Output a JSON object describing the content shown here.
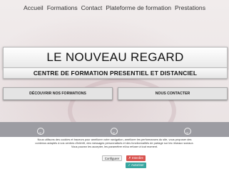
{
  "nav": {
    "items": [
      "Accueil",
      "Formations",
      "Contact",
      "Plateforme de formation",
      "Prestations"
    ]
  },
  "hero": {
    "title": "LE NOUVEAU REGARD",
    "subtitle": "CENTRE DE FORMATION PRESENTIEL ET DISTANCIEL"
  },
  "cta": {
    "left": "DÉCOUVRIR NOS FORMATIONS",
    "right": "NOUS CONTACTER"
  },
  "features": {
    "icons": [
      "smiley-icon",
      "smiley-icon",
      "smiley-icon"
    ]
  },
  "cookie_banner": {
    "text": "Nous utilisons des cookies et traceurs pour améliorer votre navigation, améliorer les performances du site, vous proposer des contenus adaptés à vos centres d'intérêt, des messages personnalisés et des fonctionnalités de partage sur les réseaux sociaux. Vous pouvez les accepter, les paramétrer et/ou refuser à tout moment.",
    "configure": "Configurer",
    "refuse": "✗ Interdire",
    "accept": "✓ Autoriser"
  },
  "colors": {
    "band": "#9c9ca2",
    "refuse": "#d9534f",
    "accept": "#3aa6a0"
  }
}
